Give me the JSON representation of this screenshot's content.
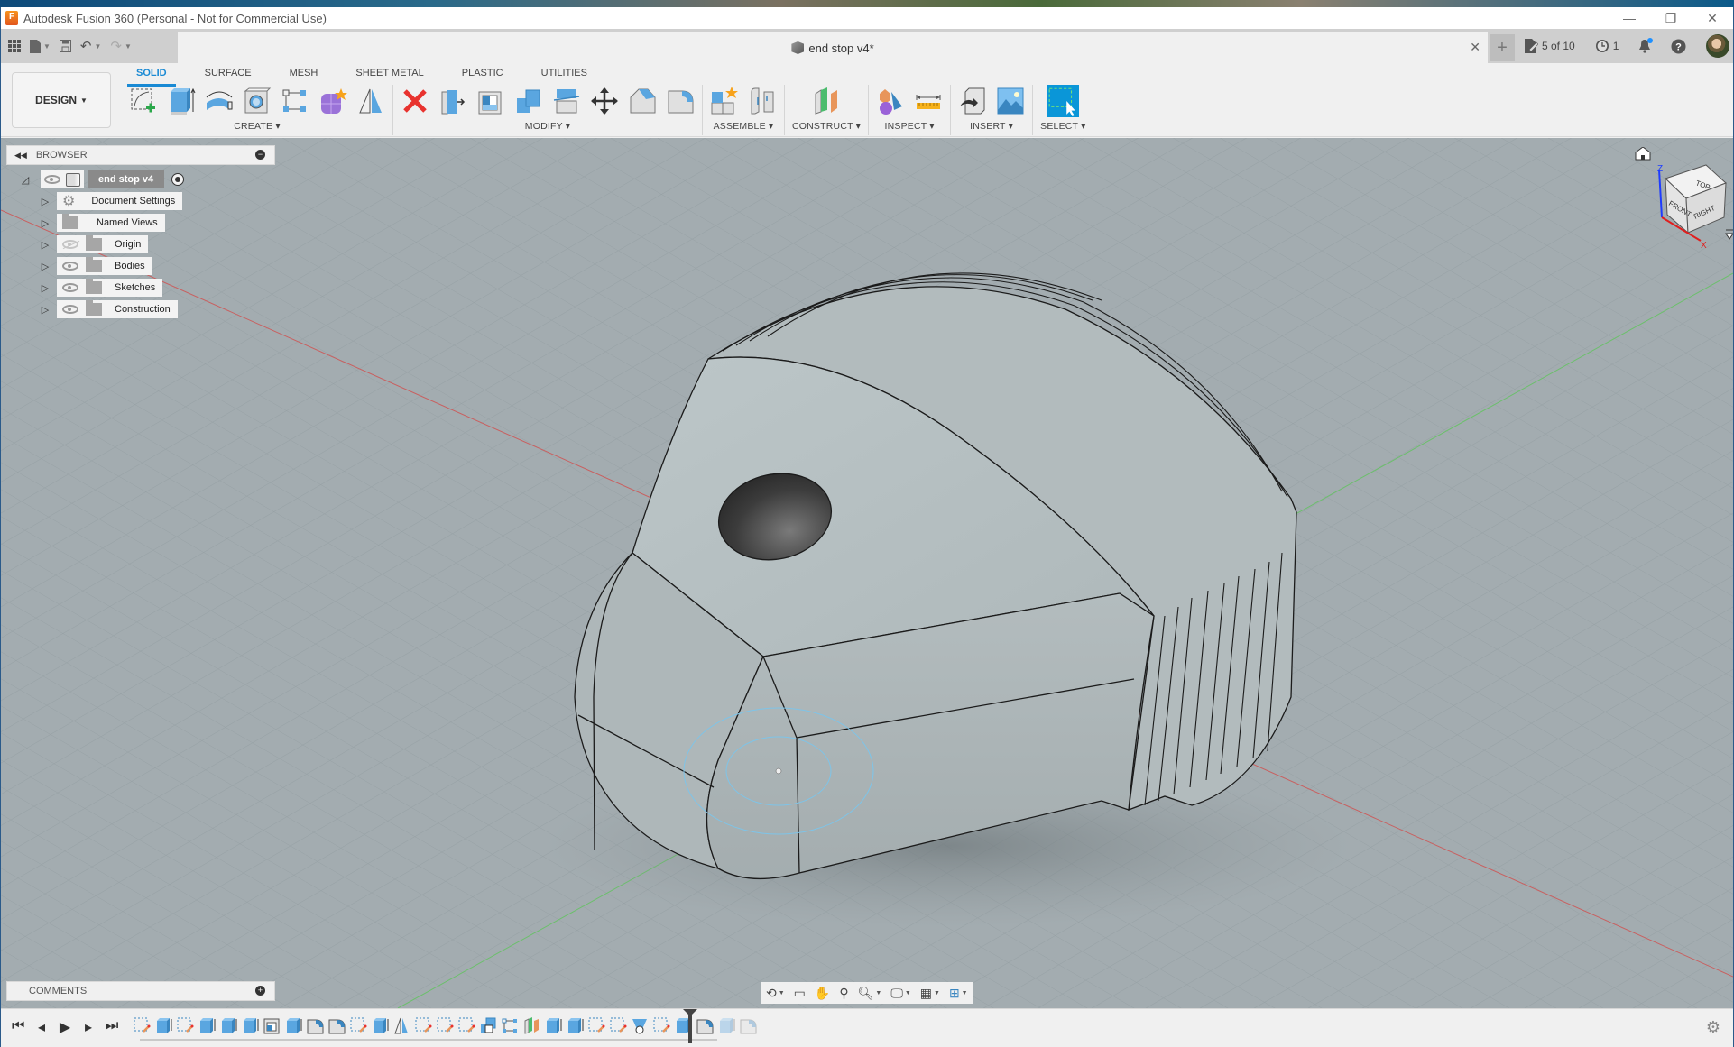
{
  "window": {
    "app_title": "Autodesk Fusion 360 (Personal - Not for Commercial Use)",
    "controls": {
      "minimize": "—",
      "restore": "❐",
      "close": "✕"
    }
  },
  "appbar": {
    "document_title": "end stop v4*",
    "close_tab": "✕",
    "new_tab": "+",
    "job_status": "5 of 10",
    "recent_jobs_count": "1"
  },
  "toolbar": {
    "workspace": "DESIGN",
    "tabs": [
      {
        "label": "SOLID",
        "active": true
      },
      {
        "label": "SURFACE",
        "active": false
      },
      {
        "label": "MESH",
        "active": false
      },
      {
        "label": "SHEET METAL",
        "active": false
      },
      {
        "label": "PLASTIC",
        "active": false
      },
      {
        "label": "UTILITIES",
        "active": false
      }
    ],
    "groups": {
      "create": "CREATE ▾",
      "modify": "MODIFY ▾",
      "assemble": "ASSEMBLE ▾",
      "construct": "CONSTRUCT ▾",
      "inspect": "INSPECT ▾",
      "insert": "INSERT ▾",
      "select": "SELECT ▾"
    }
  },
  "browser": {
    "title": "BROWSER",
    "root": "end stop v4",
    "items": [
      {
        "label": "Document Settings",
        "icon": "gear-icon",
        "visible": null
      },
      {
        "label": "Named Views",
        "icon": "folder-icon",
        "visible": null
      },
      {
        "label": "Origin",
        "icon": "folder-icon",
        "visible": false
      },
      {
        "label": "Bodies",
        "icon": "folder-icon",
        "visible": true
      },
      {
        "label": "Sketches",
        "icon": "folder-icon",
        "visible": true
      },
      {
        "label": "Construction",
        "icon": "folder-icon",
        "visible": true
      }
    ]
  },
  "comments": {
    "title": "COMMENTS"
  },
  "viewcube": {
    "top": "TOP",
    "front": "FRONT",
    "right": "RIGHT",
    "z_axis": "Z",
    "x_axis": "X"
  },
  "timeline": {
    "features": [
      "sketch",
      "extrude",
      "sketch",
      "extrude",
      "extrude",
      "extrude",
      "shell",
      "extrude",
      "fillet",
      "fillet",
      "sketch",
      "extrude",
      "mirror",
      "sketch",
      "sketch",
      "sketch",
      "combine",
      "pattern",
      "plane",
      "extrude",
      "extrude",
      "sketch",
      "sketch",
      "loft",
      "sketch",
      "extrude",
      "fillet"
    ],
    "suppressed_features": [
      "extrude",
      "fillet"
    ]
  },
  "colors": {
    "accent": "#1a8ad4",
    "viewport_bg": "#a2abaf",
    "model": "#b9c2c4"
  }
}
